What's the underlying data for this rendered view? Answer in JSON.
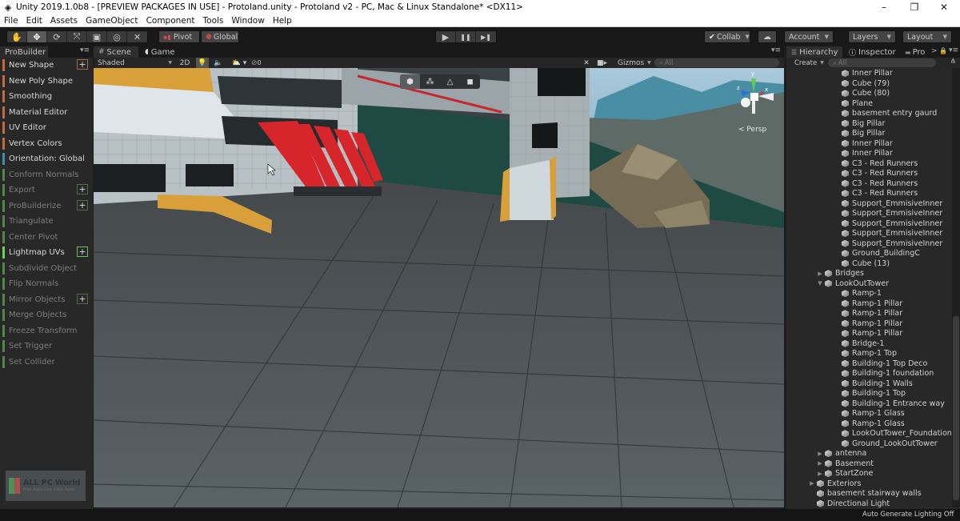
{
  "window": {
    "title": "Unity 2019.1.0b8 - [PREVIEW PACKAGES IN USE] - Protoland.unity - Protoland v2 - PC, Mac & Linux Standalone* <DX11>",
    "minimize": "–",
    "maximize": "❐",
    "close": "✕"
  },
  "menu": [
    "File",
    "Edit",
    "Assets",
    "GameObject",
    "Component",
    "Tools",
    "Window",
    "Help"
  ],
  "toolbar": {
    "tools": [
      {
        "name": "hand-tool",
        "glyph": "✋",
        "active": false
      },
      {
        "name": "move-tool",
        "glyph": "✥",
        "active": true
      },
      {
        "name": "rotate-tool",
        "glyph": "⟳",
        "active": false
      },
      {
        "name": "scale-tool",
        "glyph": "⤧",
        "active": false
      },
      {
        "name": "rect-tool",
        "glyph": "▣",
        "active": false
      },
      {
        "name": "transform-tool",
        "glyph": "◎",
        "active": false
      },
      {
        "name": "custom-tool",
        "glyph": "✕",
        "active": false
      }
    ],
    "pivot": "Pivot",
    "global": "Global",
    "play": "▶",
    "pause": "❚❚",
    "step": "▶❚",
    "collab": "Collab",
    "account": "Account",
    "layers": "Layers",
    "layout": "Layout"
  },
  "probuilder": {
    "title": "ProBuilder",
    "items": [
      {
        "label": "New Shape",
        "color": "#c76b3f",
        "dim": false,
        "plus": true,
        "plusColor": "#a06a55"
      },
      {
        "label": "New Poly Shape",
        "color": "#c76b3f",
        "dim": false,
        "plus": false
      },
      {
        "label": "Smoothing",
        "color": "#c76b3f",
        "dim": false,
        "plus": false
      },
      {
        "label": "Material Editor",
        "color": "#c76b3f",
        "dim": false,
        "plus": false
      },
      {
        "label": "UV Editor",
        "color": "#c76b3f",
        "dim": false,
        "plus": false
      },
      {
        "label": "Vertex Colors",
        "color": "#c76b3f",
        "dim": false,
        "plus": false
      },
      {
        "label": "Orientation: Global",
        "color": "#3b8fb5",
        "dim": false,
        "plus": false
      },
      {
        "label": "Conform Normals",
        "color": "#4f8a44",
        "dim": true,
        "plus": false
      },
      {
        "label": "Export",
        "color": "#4f8a44",
        "dim": true,
        "plus": true,
        "plusColor": "#4e6e48"
      },
      {
        "label": "ProBuilderize",
        "color": "#4f8a44",
        "dim": true,
        "plus": true,
        "plusColor": "#4e6e48"
      },
      {
        "label": "Triangulate",
        "color": "#4f8a44",
        "dim": true,
        "plus": false
      },
      {
        "label": "Center Pivot",
        "color": "#4f8a44",
        "dim": true,
        "plus": false
      },
      {
        "label": "Lightmap UVs",
        "color": "#6fd25e",
        "dim": false,
        "plus": true,
        "plusColor": "#6fbf5e"
      },
      {
        "label": "Subdivide Object",
        "color": "#4f8a44",
        "dim": true,
        "plus": false
      },
      {
        "label": "Flip Normals",
        "color": "#4f8a44",
        "dim": true,
        "plus": false
      },
      {
        "label": "Mirror Objects",
        "color": "#4f8a44",
        "dim": true,
        "plus": true,
        "plusColor": "#4e6e48"
      },
      {
        "label": "Merge Objects",
        "color": "#4f8a44",
        "dim": true,
        "plus": false
      },
      {
        "label": "Freeze Transform",
        "color": "#4f8a44",
        "dim": true,
        "plus": false
      },
      {
        "label": "Set Trigger",
        "color": "#4f8a44",
        "dim": true,
        "plus": false
      },
      {
        "label": "Set Collider",
        "color": "#4f8a44",
        "dim": true,
        "plus": false
      }
    ]
  },
  "watermark": {
    "brand": "ALL PC World",
    "tagline": "Free Apps One Click Away"
  },
  "scene": {
    "tabs": [
      "Scene",
      "Game"
    ],
    "shading": "Shaded",
    "mode2d": "2D",
    "hidden_count": "0",
    "gizmos": "Gizmos",
    "search_placeholder": "All",
    "persp": "Persp",
    "axes": {
      "y": "y",
      "x": "x",
      "z": "z"
    },
    "pb_modes": [
      "object-mode",
      "vertex-mode",
      "edge-mode",
      "face-mode"
    ]
  },
  "hierarchy": {
    "tabs": [
      "Hierarchy",
      "Inspector",
      "Pro"
    ],
    "create": "Create",
    "search_placeholder": "All",
    "items": [
      {
        "label": "Inner Pillar",
        "depth": 2,
        "arrow": ""
      },
      {
        "label": "Cube (79)",
        "depth": 2,
        "arrow": ""
      },
      {
        "label": "Cube (80)",
        "depth": 2,
        "arrow": ""
      },
      {
        "label": "Plane",
        "depth": 2,
        "arrow": ""
      },
      {
        "label": "basement entry gaurd",
        "depth": 2,
        "arrow": ""
      },
      {
        "label": "Big Pillar",
        "depth": 2,
        "arrow": ""
      },
      {
        "label": "Big Pillar",
        "depth": 2,
        "arrow": ""
      },
      {
        "label": "Inner Pillar",
        "depth": 2,
        "arrow": ""
      },
      {
        "label": "Inner Pillar",
        "depth": 2,
        "arrow": ""
      },
      {
        "label": "C3 - Red Runners",
        "depth": 2,
        "arrow": ""
      },
      {
        "label": "C3 - Red Runners",
        "depth": 2,
        "arrow": ""
      },
      {
        "label": "C3 - Red Runners",
        "depth": 2,
        "arrow": ""
      },
      {
        "label": "C3 - Red Runners",
        "depth": 2,
        "arrow": ""
      },
      {
        "label": "Support_EmmisiveInner",
        "depth": 2,
        "arrow": ""
      },
      {
        "label": "Support_EmmisiveInner",
        "depth": 2,
        "arrow": ""
      },
      {
        "label": "Support_EmmisiveInner",
        "depth": 2,
        "arrow": ""
      },
      {
        "label": "Support_EmmisiveInner",
        "depth": 2,
        "arrow": ""
      },
      {
        "label": "Support_EmmisiveInner",
        "depth": 2,
        "arrow": ""
      },
      {
        "label": "Ground_BuildingC",
        "depth": 2,
        "arrow": ""
      },
      {
        "label": "Cube (13)",
        "depth": 2,
        "arrow": ""
      },
      {
        "label": "Bridges",
        "depth": 1,
        "arrow": "▶"
      },
      {
        "label": "LookOutTower",
        "depth": 1,
        "arrow": "▼"
      },
      {
        "label": "Ramp-1",
        "depth": 2,
        "arrow": ""
      },
      {
        "label": "Ramp-1 Pillar",
        "depth": 2,
        "arrow": ""
      },
      {
        "label": "Ramp-1 Pillar",
        "depth": 2,
        "arrow": ""
      },
      {
        "label": "Ramp-1 Pillar",
        "depth": 2,
        "arrow": ""
      },
      {
        "label": "Ramp-1 Pillar",
        "depth": 2,
        "arrow": ""
      },
      {
        "label": "Bridge-1",
        "depth": 2,
        "arrow": ""
      },
      {
        "label": "Ramp-1 Top",
        "depth": 2,
        "arrow": ""
      },
      {
        "label": "Building-1 Top Deco",
        "depth": 2,
        "arrow": ""
      },
      {
        "label": "Building-1 foundation",
        "depth": 2,
        "arrow": ""
      },
      {
        "label": "Building-1 Walls",
        "depth": 2,
        "arrow": ""
      },
      {
        "label": "Building-1 Top",
        "depth": 2,
        "arrow": ""
      },
      {
        "label": "Building-1 Entrance way",
        "depth": 2,
        "arrow": ""
      },
      {
        "label": "Ramp-1 Glass",
        "depth": 2,
        "arrow": ""
      },
      {
        "label": "Ramp-1 Glass",
        "depth": 2,
        "arrow": ""
      },
      {
        "label": "LookOutTower_Foundation",
        "depth": 2,
        "arrow": ""
      },
      {
        "label": "Ground_LookOutTower",
        "depth": 2,
        "arrow": ""
      },
      {
        "label": "antenna",
        "depth": 1,
        "arrow": "▶"
      },
      {
        "label": "Basement",
        "depth": 1,
        "arrow": "▶"
      },
      {
        "label": "StartZone",
        "depth": 1,
        "arrow": "▶"
      },
      {
        "label": "Exteriors",
        "depth": 0,
        "arrow": "▶"
      },
      {
        "label": "basement stairway walls",
        "depth": 0,
        "arrow": ""
      },
      {
        "label": "Directional Light",
        "depth": 0,
        "arrow": ""
      }
    ]
  },
  "status": {
    "lighting": "Auto Generate Lighting Off"
  }
}
